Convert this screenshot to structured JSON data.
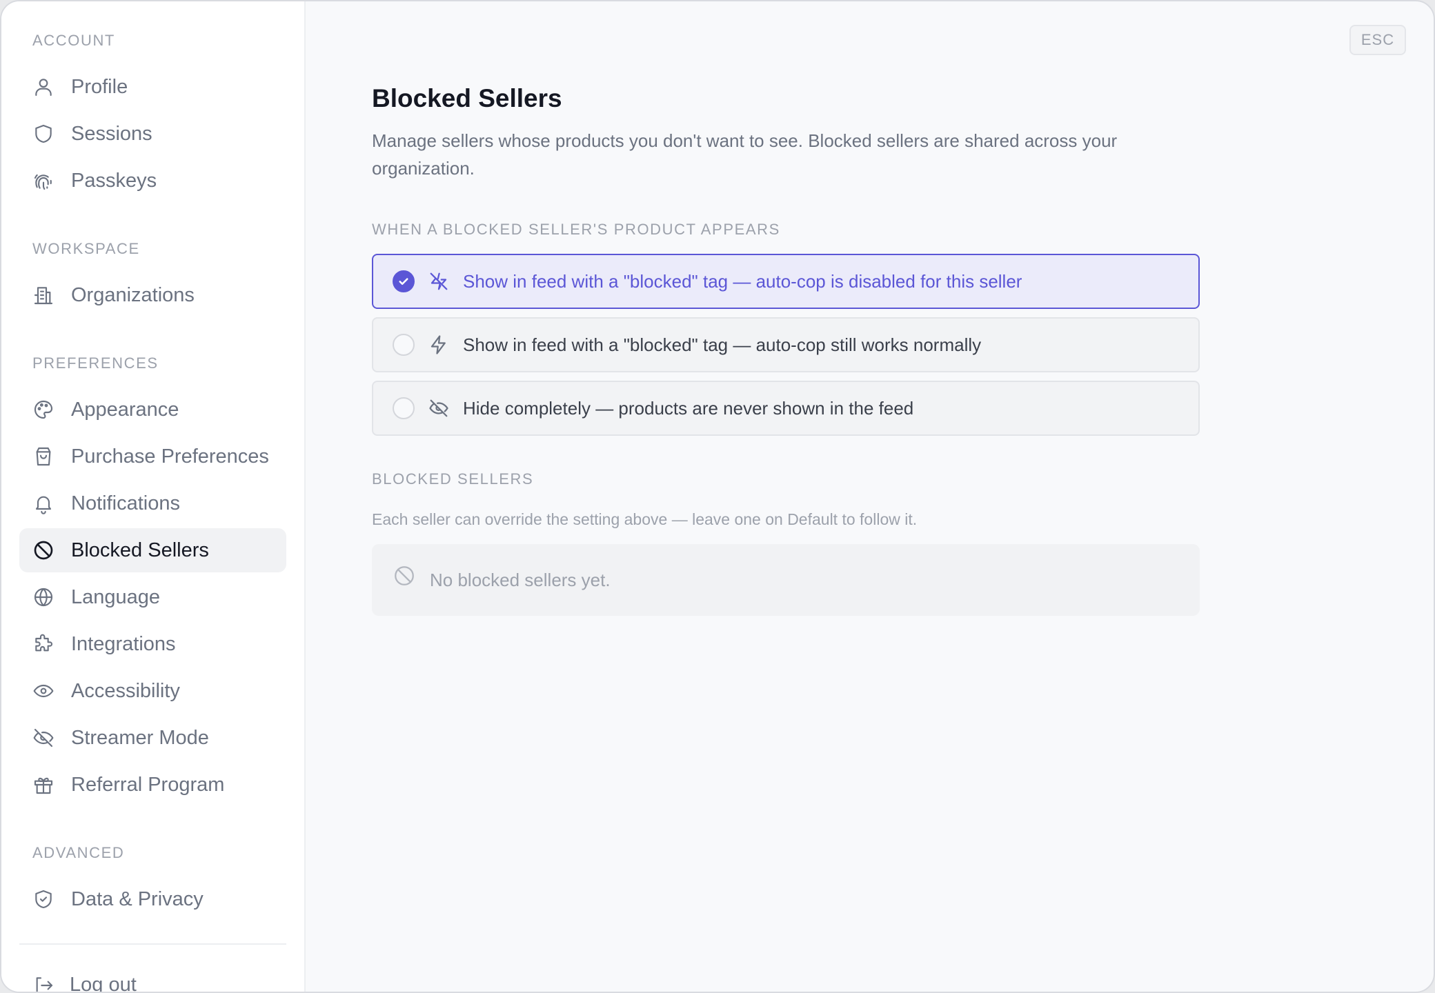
{
  "sidebar": {
    "sections": {
      "account": "ACCOUNT",
      "workspace": "WORKSPACE",
      "preferences": "PREFERENCES",
      "advanced": "ADVANCED"
    },
    "items": {
      "profile": "Profile",
      "sessions": "Sessions",
      "passkeys": "Passkeys",
      "organizations": "Organizations",
      "appearance": "Appearance",
      "purchase_preferences": "Purchase Preferences",
      "notifications": "Notifications",
      "blocked_sellers": "Blocked Sellers",
      "language": "Language",
      "integrations": "Integrations",
      "accessibility": "Accessibility",
      "streamer_mode": "Streamer Mode",
      "referral_program": "Referral Program",
      "data_privacy": "Data & Privacy"
    },
    "active_item": "blocked_sellers",
    "logout": "Log out"
  },
  "esc_label": "ESC",
  "main": {
    "title": "Blocked Sellers",
    "description": "Manage sellers whose products you don't want to see. Blocked sellers are shared across your organization.",
    "behavior_label": "WHEN A BLOCKED SELLER'S PRODUCT APPEARS",
    "options": [
      {
        "label": "Show in feed with a \"blocked\" tag — auto-cop is disabled for this seller",
        "icon": "zap-off-icon",
        "selected": true
      },
      {
        "label": "Show in feed with a \"blocked\" tag — auto-cop still works normally",
        "icon": "zap-icon",
        "selected": false
      },
      {
        "label": "Hide completely — products are never shown in the feed",
        "icon": "eye-off-icon",
        "selected": false
      }
    ],
    "list_label": "BLOCKED SELLERS",
    "list_hint": "Each seller can override the setting above — leave one on Default to follow it.",
    "empty_text": "No blocked sellers yet."
  },
  "colors": {
    "accent": "#5b56d6",
    "accent_bg": "#ebebfa",
    "muted": "#9ca1ab",
    "text": "#151823"
  }
}
